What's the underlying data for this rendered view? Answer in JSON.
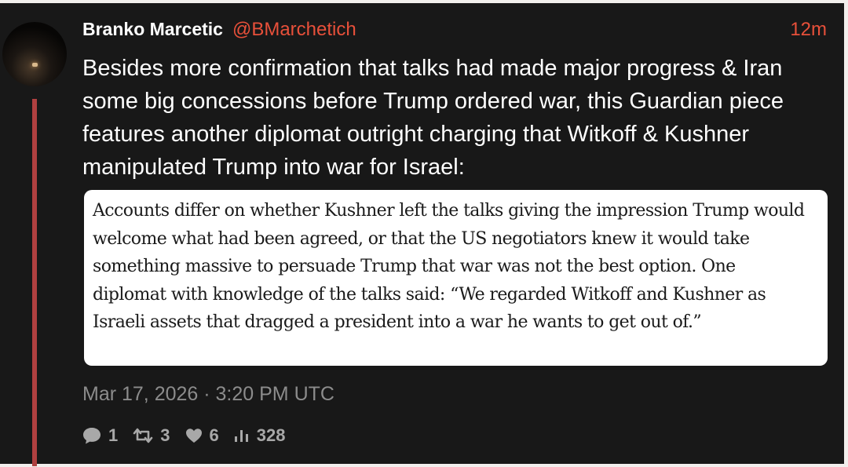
{
  "post": {
    "author_name": "Branko Marcetic",
    "author_handle": "@BMarchetich",
    "relative_time": "12m",
    "text": "Besides more confirmation that talks had made major progress & Iran some big concessions before Trump ordered war, this Guardian piece features another diplomat outright charging that Witkoff & Kushner manipulated Trump into war for Israel:",
    "quoted_excerpt": "Accounts differ on whether Kushner left the talks giving the impression Trump would welcome what had been agreed, or that the US negotiators knew it would take something massive to persuade Trump that war was not the best option. One diplomat with knowledge of the talks said: “We regarded Witkoff and Kushner as Israeli assets that dragged a president into a war he wants to get out of.”",
    "timestamp": "Mar 17, 2026 · 3:20 PM UTC"
  },
  "stats": {
    "replies": "1",
    "reposts": "3",
    "likes": "6",
    "views": "328"
  },
  "colors": {
    "accent": "#e8503a",
    "thread_line": "#b04040",
    "background": "#181818",
    "muted_text": "#8c8c8c"
  },
  "icons": {
    "reply": "comment-bubble-icon",
    "repost": "repost-icon",
    "like": "heart-icon",
    "views": "bar-chart-icon"
  }
}
